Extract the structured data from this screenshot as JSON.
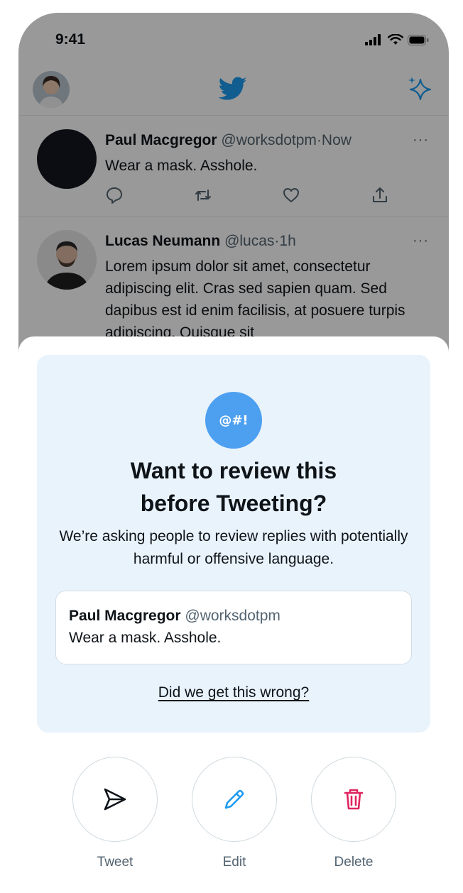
{
  "status_bar": {
    "time": "9:41"
  },
  "header": {
    "logo": "twitter-bird-icon",
    "sparkle": "sparkle-icon"
  },
  "timeline": [
    {
      "name": "Paul Macgregor",
      "handle": "@worksdotpm",
      "sep": "·",
      "time": "Now",
      "more": "···",
      "text": "Wear a mask. Asshole."
    },
    {
      "name": "Lucas Neumann",
      "handle": "@lucas",
      "sep": "·",
      "time": "1h",
      "more": "···",
      "text": "Lorem ipsum dolor sit amet, consectetur adipiscing elit. Cras sed sapien quam. Sed dapibus est id enim facilisis, at posuere turpis adipiscing. Quisque sit"
    }
  ],
  "review_prompt": {
    "badge": "@#!",
    "title_line1": "Want to review this",
    "title_line2": "before Tweeting?",
    "subtitle": "We’re asking people to review replies with potentially harmful or offensive language.",
    "quote": {
      "name": "Paul Macgregor",
      "handle": "@worksdotpm",
      "text": "Wear a mask. Asshole."
    },
    "feedback_link": "Did we get this wrong?"
  },
  "actions": [
    {
      "label": "Tweet",
      "icon": "send-icon"
    },
    {
      "label": "Edit",
      "icon": "pencil-icon"
    },
    {
      "label": "Delete",
      "icon": "trash-icon"
    }
  ],
  "colors": {
    "accent": "#1d9bf0",
    "badge": "#4d9ff0",
    "card_bg": "#e9f3fc",
    "delete": "#e0245e"
  }
}
